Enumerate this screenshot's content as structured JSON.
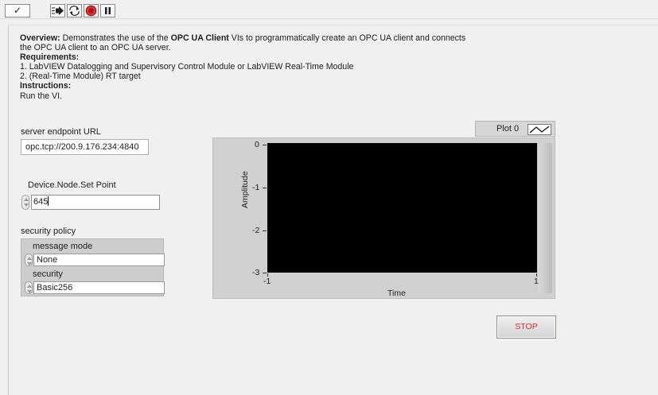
{
  "toolbar": {
    "check_glyph": "✓",
    "buttons": [
      "run-arrow-icon",
      "run-continuously-icon",
      "abort-icon",
      "pause-icon"
    ]
  },
  "overview": {
    "overview_label": "Overview:",
    "line1_a": " Demonstrates the use of the ",
    "line1_bold": "OPC UA Client",
    "line1_b": " VIs to programmatically create an OPC UA client and connects",
    "line2": "the OPC UA client to an OPC UA server.",
    "requirements_label": "Requirements:",
    "req1": "1. LabVIEW Datalogging and Supervisory Control Module or LabVIEW Real-Time Module",
    "req2": "2. (Real-Time Module) RT target",
    "instructions_label": "Instructions:",
    "instructions": "Run the VI."
  },
  "server_endpoint": {
    "label": "server endpoint URL",
    "value": "opc.tcp://200.9.176.234:4840"
  },
  "set_point": {
    "label": "Device.Node.Set Point",
    "value": "645"
  },
  "security_policy": {
    "label": "security policy",
    "message_mode_label": "message mode",
    "message_mode_value": "None",
    "security_label": "security",
    "security_value": "Basic256"
  },
  "graph": {
    "legend_name": "Plot 0",
    "y_label": "Amplitude",
    "x_label": "Time",
    "y_ticks": [
      "0",
      "-1",
      "-2",
      "-3"
    ],
    "x_min": "-1",
    "x_max": "1",
    "plot_background": "#000000"
  },
  "stop_button": {
    "label": "STOP",
    "color": "#d42a2a"
  }
}
